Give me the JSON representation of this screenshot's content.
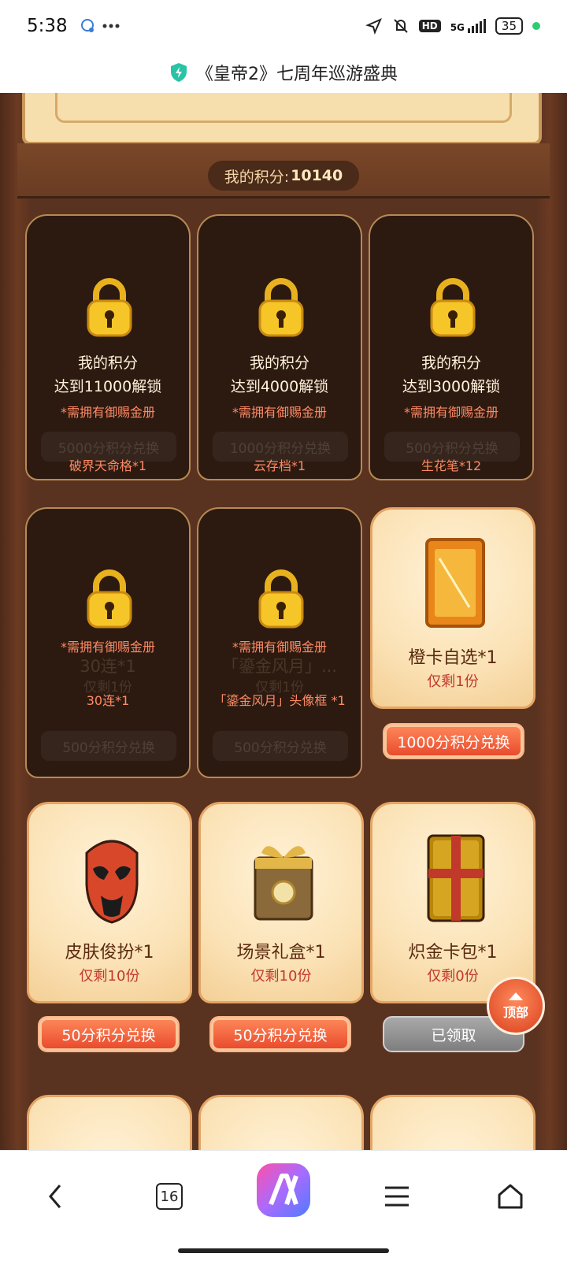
{
  "status_bar": {
    "time": "5:38",
    "left_icons": [
      "chat-bubble-icon",
      "more-dots-icon"
    ],
    "right_icons": [
      "location-icon",
      "mute-icon",
      "hd-icon",
      "signal-5g-icon"
    ],
    "hd": "HD",
    "network": "5G",
    "battery": "35"
  },
  "title_bar": {
    "title": "《皇帝2》七周年巡游盛典"
  },
  "score": {
    "label": "我的积分:",
    "value": "10140"
  },
  "locked_cards": [
    {
      "unlock_line1": "我的积分",
      "unlock_line2": "达到11000解锁",
      "requirement": "*需拥有御赐金册",
      "item": "破界天命格*1",
      "ghost_price": "5000分积分兑换"
    },
    {
      "unlock_line1": "我的积分",
      "unlock_line2": "达到4000解锁",
      "requirement": "*需拥有御赐金册",
      "item": "云存档*1",
      "ghost_price": "1000分积分兑换"
    },
    {
      "unlock_line1": "我的积分",
      "unlock_line2": "达到3000解锁",
      "requirement": "*需拥有御赐金册",
      "item": "生花笔*12",
      "ghost_price": "500分积分兑换"
    },
    {
      "requirement": "*需拥有御赐金册",
      "item": "30连*1",
      "ghost_name": "30连*1",
      "ghost_stock": "仅剩1份",
      "ghost_price": "500分积分兑换"
    },
    {
      "requirement": "*需拥有御赐金册",
      "item": "「鎏金风月」头像框 *1",
      "ghost_name": "「鎏金风月」...",
      "ghost_stock": "仅剩1份",
      "ghost_price": "500分积分兑换"
    }
  ],
  "open_cards": [
    {
      "name": "橙卡自选*1",
      "stock": "仅剩1份",
      "button": "1000分积分兑换",
      "state": "redeem"
    },
    {
      "name": "皮肤俊扮*1",
      "stock": "仅剩10份",
      "button": "50分积分兑换",
      "state": "redeem"
    },
    {
      "name": "场景礼盒*1",
      "stock": "仅剩10份",
      "button": "50分积分兑换",
      "state": "redeem"
    },
    {
      "name": "炽金卡包*1",
      "stock": "仅剩0份",
      "button": "已领取",
      "state": "claimed"
    }
  ],
  "float_button": {
    "label": "顶部"
  },
  "bottom_nav": {
    "tab_count": "16",
    "items": [
      "back-icon",
      "tabs-icon",
      "assistant-app-icon",
      "menu-icon",
      "home-icon"
    ]
  },
  "colors": {
    "wood": "#5a3220",
    "card_locked_bg": "#2c1a10",
    "card_open_bg": "#fbe2b6",
    "accent_red": "#e8472a",
    "text_orange": "#ff8a65"
  }
}
